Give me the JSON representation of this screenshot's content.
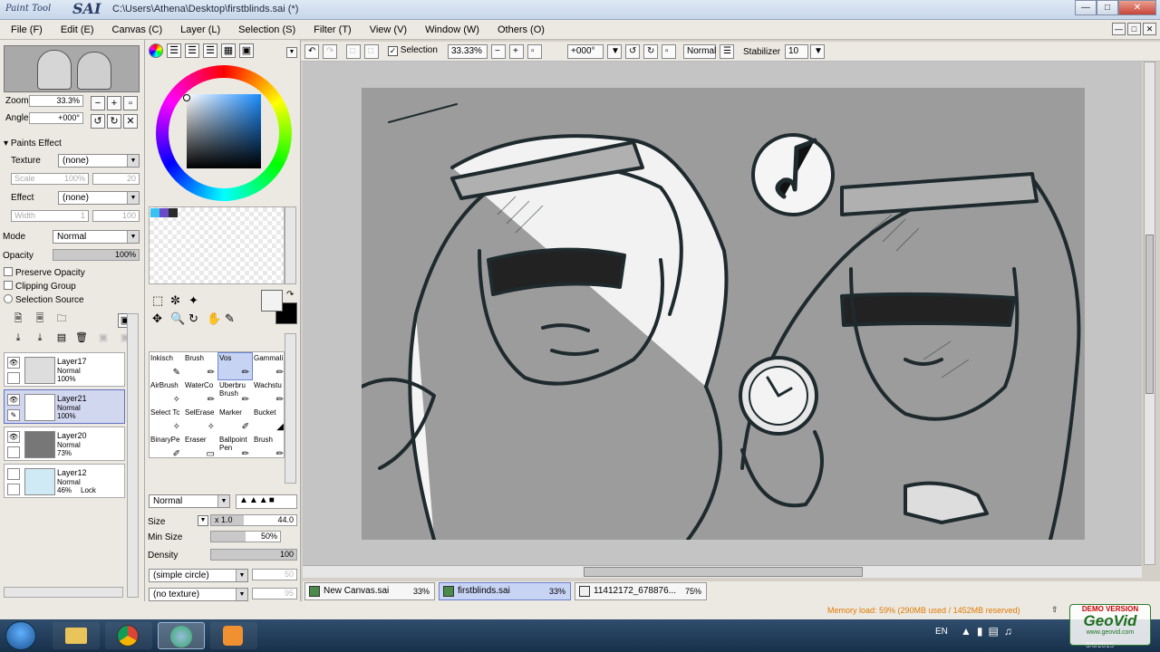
{
  "window": {
    "logo_small": "Paint Tool",
    "logo_big": "SAI",
    "title": "C:\\Users\\Athena\\Desktop\\firstblinds.sai (*)"
  },
  "menu": [
    "File (F)",
    "Edit (E)",
    "Canvas (C)",
    "Layer (L)",
    "Selection (S)",
    "Filter (T)",
    "View (V)",
    "Window (W)",
    "Others (O)"
  ],
  "navigator": {
    "zoom_label": "Zoom",
    "zoom_value": "33.3%",
    "angle_label": "Angle",
    "angle_value": "+000°"
  },
  "paint_effect": {
    "header": "Paints Effect",
    "texture_label": "Texture",
    "texture_value": "(none)",
    "scale_label": "Scale",
    "scale_value": "100%",
    "scale_right": "20",
    "effect_label": "Effect",
    "effect_value": "(none)",
    "width_label": "Width",
    "width_value": "1",
    "width_right": "100"
  },
  "layer_props": {
    "mode_label": "Mode",
    "mode_value": "Normal",
    "opacity_label": "Opacity",
    "opacity_value": "100%",
    "preserve_opacity": "Preserve Opacity",
    "clipping_group": "Clipping Group",
    "selection_source": "Selection Source"
  },
  "layers": [
    {
      "name": "Layer17",
      "mode": "Normal",
      "opacity": "100%",
      "lock": "",
      "selected": false,
      "visible": true
    },
    {
      "name": "Layer21",
      "mode": "Normal",
      "opacity": "100%",
      "lock": "",
      "selected": true,
      "visible": true
    },
    {
      "name": "Layer20",
      "mode": "Normal",
      "opacity": "73%",
      "lock": "",
      "selected": false,
      "visible": true
    },
    {
      "name": "Layer12",
      "mode": "Normal",
      "opacity": "46%",
      "lock": "Lock",
      "selected": false,
      "visible": false
    }
  ],
  "brushes": [
    {
      "name": "Inkisch",
      "icon": "✎"
    },
    {
      "name": "Brush",
      "icon": "✏"
    },
    {
      "name": "Vos",
      "icon": "✏",
      "selected": true
    },
    {
      "name": "GammaIi",
      "icon": "✏"
    },
    {
      "name": "AirBrush",
      "icon": "✧"
    },
    {
      "name": "WaterCo",
      "icon": "✏"
    },
    {
      "name": "Uberbru Brush",
      "icon": "✏"
    },
    {
      "name": "Wachstu",
      "icon": "✏"
    },
    {
      "name": "Select Tc",
      "icon": "✧"
    },
    {
      "name": "SelErase",
      "icon": "✧"
    },
    {
      "name": "Marker",
      "icon": "✐"
    },
    {
      "name": "Bucket",
      "icon": "◢"
    },
    {
      "name": "BinaryPe",
      "icon": "✐"
    },
    {
      "name": "Eraser",
      "icon": "▭"
    },
    {
      "name": "Ballpoint Pen",
      "icon": "✏"
    },
    {
      "name": "Brush",
      "icon": "✏"
    }
  ],
  "brush_settings": {
    "blend_mode": "Normal",
    "size_label": "Size",
    "size_mult": "x 1.0",
    "size_value": "44.0",
    "minsize_label": "Min Size",
    "minsize_value": "50%",
    "density_label": "Density",
    "density_value": "100",
    "shape_value": "(simple circle)",
    "shape_right": "50",
    "texture_value": "(no texture)",
    "texture_right": "95"
  },
  "toolbar": {
    "selection_label": "Selection",
    "zoom": "33.33%",
    "rotation": "+000°",
    "mode": "Normal",
    "stabilizer_label": "Stabilizer",
    "stabilizer_value": "10"
  },
  "tabs": [
    {
      "name": "New Canvas.sai",
      "zoom": "33%",
      "active": false
    },
    {
      "name": "firstblinds.sai",
      "zoom": "33%",
      "active": true
    },
    {
      "name": "11412172_678876...",
      "zoom": "75%",
      "active": false
    }
  ],
  "status": {
    "memory": "Memory load: 59% (290MB used / 1452MB reserved)"
  },
  "taskbar": {
    "lang": "EN",
    "clock": "6/6/2015"
  },
  "watermark": {
    "top": "DEMO VERSION",
    "brand": "GeoVid",
    "url": "www.geovid.com"
  },
  "colors": {
    "accent": "#c8d4f4",
    "canvas_bg": "#9c9c9c",
    "line": "#1e2a2e"
  }
}
